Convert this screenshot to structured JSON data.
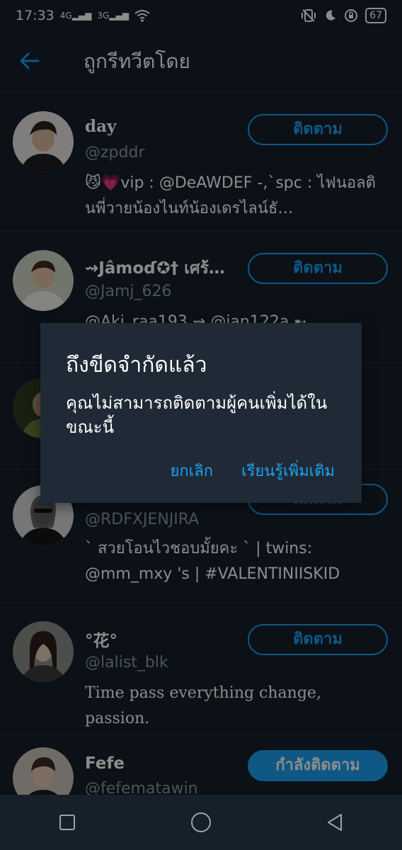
{
  "status_bar": {
    "time": "17:33",
    "signal1_label": "4G",
    "signal2_label": "3G",
    "battery": "67"
  },
  "header": {
    "title": "ถูกรีทวีตโดย"
  },
  "users": [
    {
      "name": "day",
      "handle": "@zpddr",
      "bio": "😼💗vip : @DeAWDEF -,`spc : ไฟนอลตินพี่วายน้องไนท์น้องเดรไลน์ธั…",
      "follow_label": "ติดตาม"
    },
    {
      "name": "⇝Jâmoɗ✪† เศร้…",
      "handle": "@Jamj_626",
      "bio": "@Aki_raa193 ⇝ @jan122a ➸",
      "follow_label": "ติดตาม"
    },
    {
      "name": "",
      "handle": "",
      "bio": "",
      "follow_label": ""
    },
    {
      "name": "",
      "handle": "@RDFXJENJIRA",
      "bio": "` สวยโอนไวชอบมั้ยคะ ` | twins: @mm_mxy 's | #VALENTINIISKID",
      "follow_label": "ติดตาม"
    },
    {
      "name": "°花°",
      "handle": "@lalist_blk",
      "bio": "Time pass everything change, passion.",
      "follow_label": "ติดตาม"
    },
    {
      "name": "Fefe",
      "handle": "@fefematawin",
      "bio": "",
      "follow_label": "กำลังติดตาม"
    }
  ],
  "dialog": {
    "title": "ถึงขีดจำกัดแล้ว",
    "message": "คุณไม่สามารถติดตามผู้คนเพิ่มได้ในขณะนี้",
    "cancel_label": "ยกเลิก",
    "learn_more_label": "เรียนรู้เพิ่มเติม"
  },
  "colors": {
    "background": "#15202b",
    "accent": "#1da1f2",
    "dialog": "#1f2a36",
    "secondary_text": "#8899a6"
  },
  "icons": {
    "back": "arrow-left-icon",
    "nav": [
      "square-icon",
      "circle-icon",
      "triangle-left-icon"
    ]
  }
}
